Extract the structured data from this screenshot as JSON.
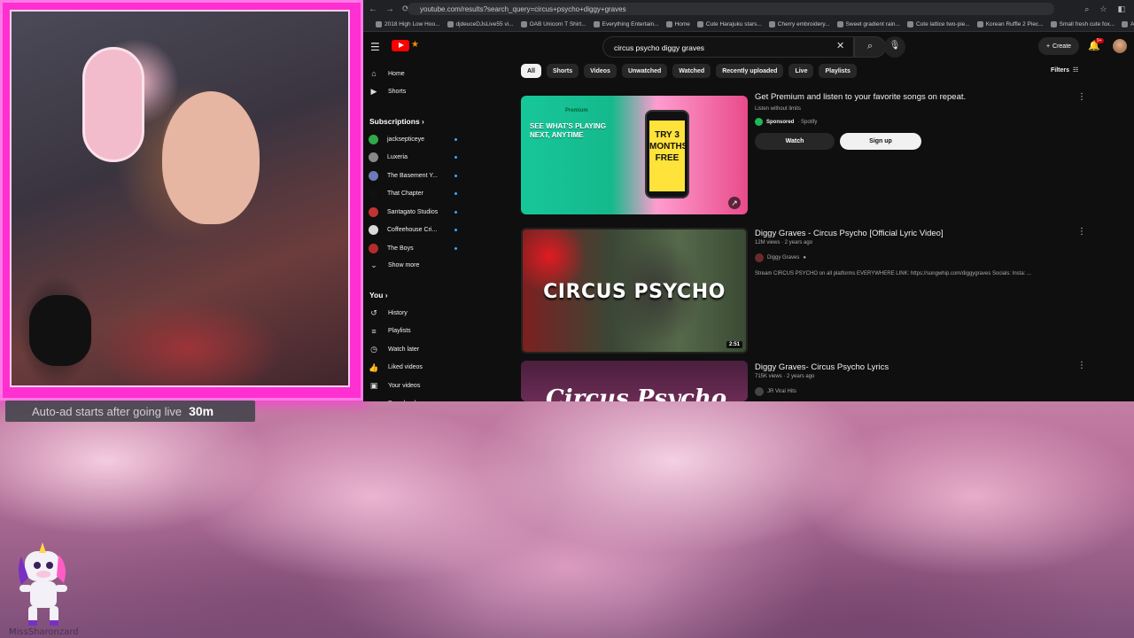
{
  "overlay": {
    "autoad_text": "Auto-ad starts after going live",
    "autoad_time": "30m",
    "username": "MissSharonzard"
  },
  "browser": {
    "url": "youtube.com/results?search_query=circus+psycho+diggy+graves",
    "bookmarks": [
      "2018 High Low Hoo...",
      "djdeuceDJsLive55 vi...",
      "OAB Unicorn T Shirt...",
      "Everything Entertain...",
      "Home",
      "Cute Harajuku stars...",
      "Cherry embroidery...",
      "Sweet gradient rain...",
      "Cute lattice two-pie...",
      "Korean Ruffle 2 Piec...",
      "Small fresh cute fox...",
      "All Bookm"
    ]
  },
  "yt": {
    "search_value": "circus psycho diggy graves",
    "create_label": "Create",
    "bell_badge": "9+",
    "sidebar": {
      "home": "Home",
      "shorts": "Shorts",
      "subscriptions": "Subscriptions",
      "channels": [
        {
          "name": "jacksepticeye",
          "color": "#2ea84a"
        },
        {
          "name": "Luxeria",
          "color": "#888888"
        },
        {
          "name": "The Basement Y...",
          "color": "#6a7bb5"
        },
        {
          "name": "That Chapter",
          "color": "#111111"
        },
        {
          "name": "Santagato Studios",
          "color": "#c23434"
        },
        {
          "name": "Coffeehouse Cri...",
          "color": "#d9d9d9"
        },
        {
          "name": "The Boys",
          "color": "#b52b2b"
        }
      ],
      "show_more": "Show more",
      "you": "You",
      "you_items": [
        "History",
        "Playlists",
        "Watch later",
        "Liked videos",
        "Your videos",
        "Downloads"
      ]
    },
    "chips": [
      "All",
      "Shorts",
      "Videos",
      "Unwatched",
      "Watched",
      "Recently uploaded",
      "Live",
      "Playlists"
    ],
    "filters": "Filters",
    "ad": {
      "title": "Get Premium and listen to your favorite songs on repeat.",
      "subtitle": "Listen without limits",
      "sponsored": "Sponsored",
      "advertiser": "· Spotify",
      "watch": "Watch",
      "signup": "Sign up",
      "thumb_premium": "Premium",
      "thumb_headline": "SEE WHAT'S PLAYING NEXT, ANYTIME",
      "thumb_offer": "TRY 3 MONTHS FREE"
    },
    "results": [
      {
        "title": "Diggy Graves - Circus Psycho [Official Lyric Video]",
        "meta": "12M views · 2 years ago",
        "channel": "Diggy Graves",
        "desc": "Stream CIRCUS PSYCHO on all platforms EVERYWHERE LINK: https://songwhip.com/diggygraves Socials: Insta: ...",
        "thumb_text": "CIRCUS PSYCHO",
        "duration": "2:51"
      },
      {
        "title": "Diggy Graves- Circus Psycho Lyrics",
        "meta": "715K views · 2 years ago",
        "channel": "JR Viral Hits",
        "thumb_text": "Circus Psycho"
      }
    ]
  }
}
